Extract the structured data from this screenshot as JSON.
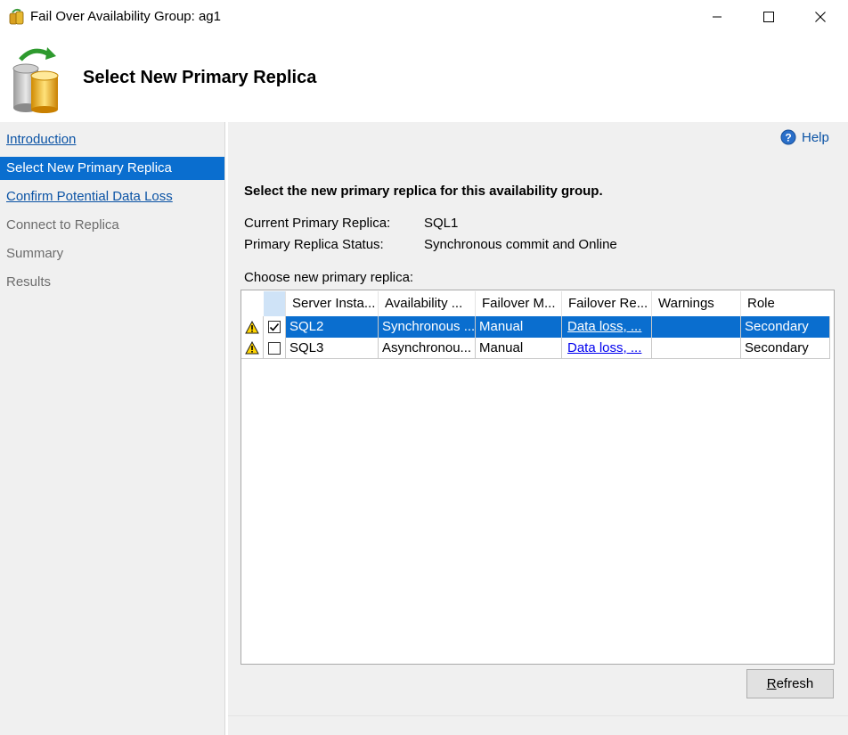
{
  "window": {
    "title": "Fail Over Availability Group: ag1"
  },
  "header": {
    "title": "Select New Primary Replica"
  },
  "sidebar": {
    "items": [
      {
        "label": "Introduction",
        "state": "link"
      },
      {
        "label": "Select New Primary Replica",
        "state": "selected"
      },
      {
        "label": "Confirm Potential Data Loss",
        "state": "link"
      },
      {
        "label": "Connect to Replica",
        "state": "disabled"
      },
      {
        "label": "Summary",
        "state": "disabled"
      },
      {
        "label": "Results",
        "state": "disabled"
      }
    ]
  },
  "main": {
    "help_label": "Help",
    "instruction": "Select the new primary replica for this availability group.",
    "current_primary_label": "Current Primary Replica:",
    "current_primary_value": "SQL1",
    "status_label": "Primary Replica Status:",
    "status_value": "Synchronous commit and Online",
    "choose_label": "Choose new primary replica:",
    "refresh_first": "R",
    "refresh_rest": "efresh"
  },
  "grid": {
    "columns": [
      "Server Insta...",
      "Availability ...",
      "Failover M...",
      "Failover Re...",
      "Warnings",
      "Role"
    ],
    "rows": [
      {
        "checked": true,
        "selected": true,
        "warning_icon": "warning-icon",
        "server": "SQL2",
        "availability": "Synchronous ...",
        "failover_mode": "Manual",
        "failover_readiness": "Data loss, ...",
        "warnings": "",
        "role": "Secondary"
      },
      {
        "checked": false,
        "selected": false,
        "warning_icon": "warning-icon",
        "server": "SQL3",
        "availability": "Asynchronou...",
        "failover_mode": "Manual",
        "failover_readiness": "Data loss, ...",
        "warnings": "",
        "role": "Secondary"
      }
    ]
  },
  "colors": {
    "accent": "#0a6ecf",
    "link": "#0b53a5",
    "panel": "#f0f0f0"
  }
}
